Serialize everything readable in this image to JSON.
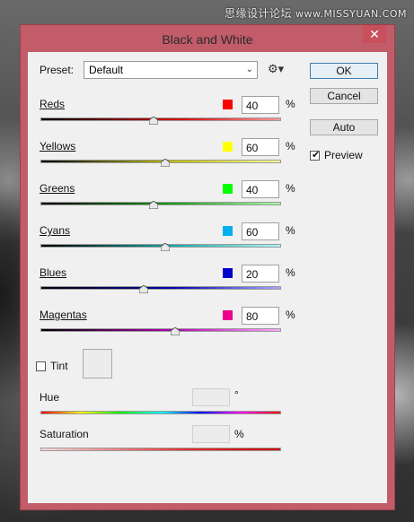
{
  "watermark": {
    "cn": "思缘设计论坛",
    "url": "www.MISSYUAN.COM"
  },
  "window": {
    "title": "Black and White",
    "close_glyph": "✕"
  },
  "preset": {
    "label": "Preset:",
    "value": "Default",
    "chevron": "⌄",
    "gear": "⚙▾"
  },
  "buttons": {
    "ok": "OK",
    "cancel": "Cancel",
    "auto": "Auto"
  },
  "preview": {
    "label": "Preview",
    "checked": true
  },
  "percent_sign": "%",
  "channels": [
    {
      "label": "Reds",
      "value": "40",
      "swatch": "#ff0000",
      "fraction": 0.47,
      "track": "linear-gradient(90deg,#000,#c00 55%,#f99)"
    },
    {
      "label": "Yellows",
      "value": "60",
      "swatch": "#ffff00",
      "fraction": 0.52,
      "track": "linear-gradient(90deg,#000,#bdbd00 55%,#ffff9a)"
    },
    {
      "label": "Greens",
      "value": "40",
      "swatch": "#00ff00",
      "fraction": 0.47,
      "track": "linear-gradient(90deg,#000,#1a9a1a 55%,#a7ffa7)"
    },
    {
      "label": "Cyans",
      "value": "60",
      "swatch": "#00aeef",
      "fraction": 0.52,
      "track": "linear-gradient(90deg,#000,#12a7a7 55%,#a8ffff)"
    },
    {
      "label": "Blues",
      "value": "20",
      "swatch": "#0000cc",
      "fraction": 0.43,
      "track": "linear-gradient(90deg,#000,#0000b0 55%,#a8a8ff)"
    },
    {
      "label": "Magentas",
      "value": "80",
      "swatch": "#ec008c",
      "fraction": 0.56,
      "track": "linear-gradient(90deg,#000,#b000b0 55%,#ffa8ff)"
    }
  ],
  "tint": {
    "label": "Tint",
    "checked": false
  },
  "hue": {
    "label": "Hue",
    "unit": "°",
    "track": "linear-gradient(90deg,#f00,#ff0 17%,#0f0 33%,#0ff 50%,#00f 67%,#f0f 83%,#f00)"
  },
  "saturation": {
    "label": "Saturation",
    "unit": "%",
    "track": "linear-gradient(90deg,#f7dada,#e23131 60%,#cc0000)"
  }
}
